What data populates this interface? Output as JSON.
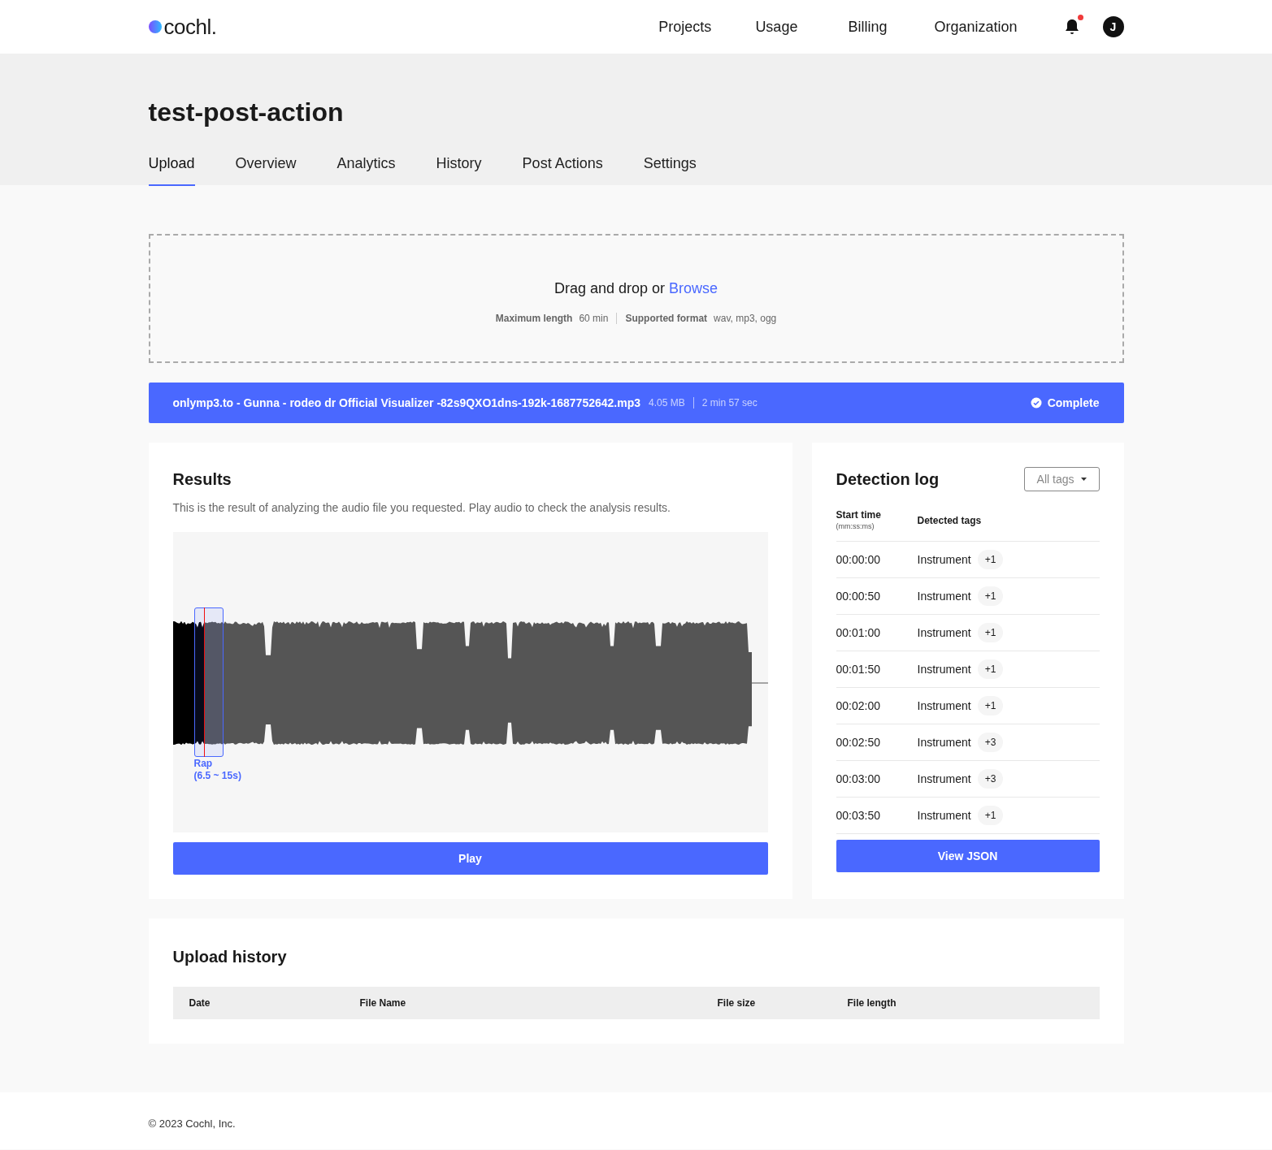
{
  "header": {
    "logo": "cochl.",
    "nav": [
      "Projects",
      "Usage",
      "Billing",
      "Organization"
    ],
    "notification_unread": true,
    "avatar": "J"
  },
  "project": {
    "title": "test-post-action"
  },
  "tabs": [
    {
      "label": "Upload",
      "selected": true
    },
    {
      "label": "Overview",
      "selected": false
    },
    {
      "label": "Analytics",
      "selected": false
    },
    {
      "label": "History",
      "selected": false
    },
    {
      "label": "Post Actions",
      "selected": false
    },
    {
      "label": "Settings",
      "selected": false
    }
  ],
  "dropzone": {
    "prompt": "Drag and drop or",
    "link": "Browse",
    "limits": [
      {
        "label": "Maximum length",
        "value": "60 min"
      },
      {
        "label": "Supported format",
        "value": "wav, mp3, ogg"
      }
    ]
  },
  "file_bar": {
    "name": "onlymp3.to - Gunna - rodeo dr Official Visualizer -82s9QXO1dns-192k-1687752642.mp3",
    "size": "4.05 MB",
    "length": "2 min 57 sec",
    "status": "Complete"
  },
  "results": {
    "title": "Results",
    "description": "This is the result of analyzing the audio file you requested. Play audio to check the analysis results.",
    "player": {
      "level": 0.053,
      "segment": {
        "tag": "Rap",
        "range": "(6.5 ~ 15s)"
      }
    },
    "play_button": "Play"
  },
  "detection_log": {
    "title": "Detection log",
    "filter": "All tags",
    "columns": [
      {
        "label": "Start time",
        "hint": "(mm:ss:ms)"
      },
      {
        "label": "Detected tags"
      }
    ],
    "rows": [
      {
        "time": "00:00:00",
        "tag": "Instrument",
        "more": "+1"
      },
      {
        "time": "00:00:50",
        "tag": "Instrument",
        "more": "+1"
      },
      {
        "time": "00:01:00",
        "tag": "Instrument",
        "more": "+1"
      },
      {
        "time": "00:01:50",
        "tag": "Instrument",
        "more": "+1"
      },
      {
        "time": "00:02:00",
        "tag": "Instrument",
        "more": "+1"
      },
      {
        "time": "00:02:50",
        "tag": "Instrument",
        "more": "+3"
      },
      {
        "time": "00:03:00",
        "tag": "Instrument",
        "more": "+3"
      },
      {
        "time": "00:03:50",
        "tag": "Instrument",
        "more": "+1"
      }
    ],
    "button": "View JSON"
  },
  "upload_history": {
    "title": "Upload history",
    "columns": [
      "Date",
      "File Name",
      "File size",
      "File length"
    ]
  },
  "footer": "© 2023 Cochl, Inc."
}
